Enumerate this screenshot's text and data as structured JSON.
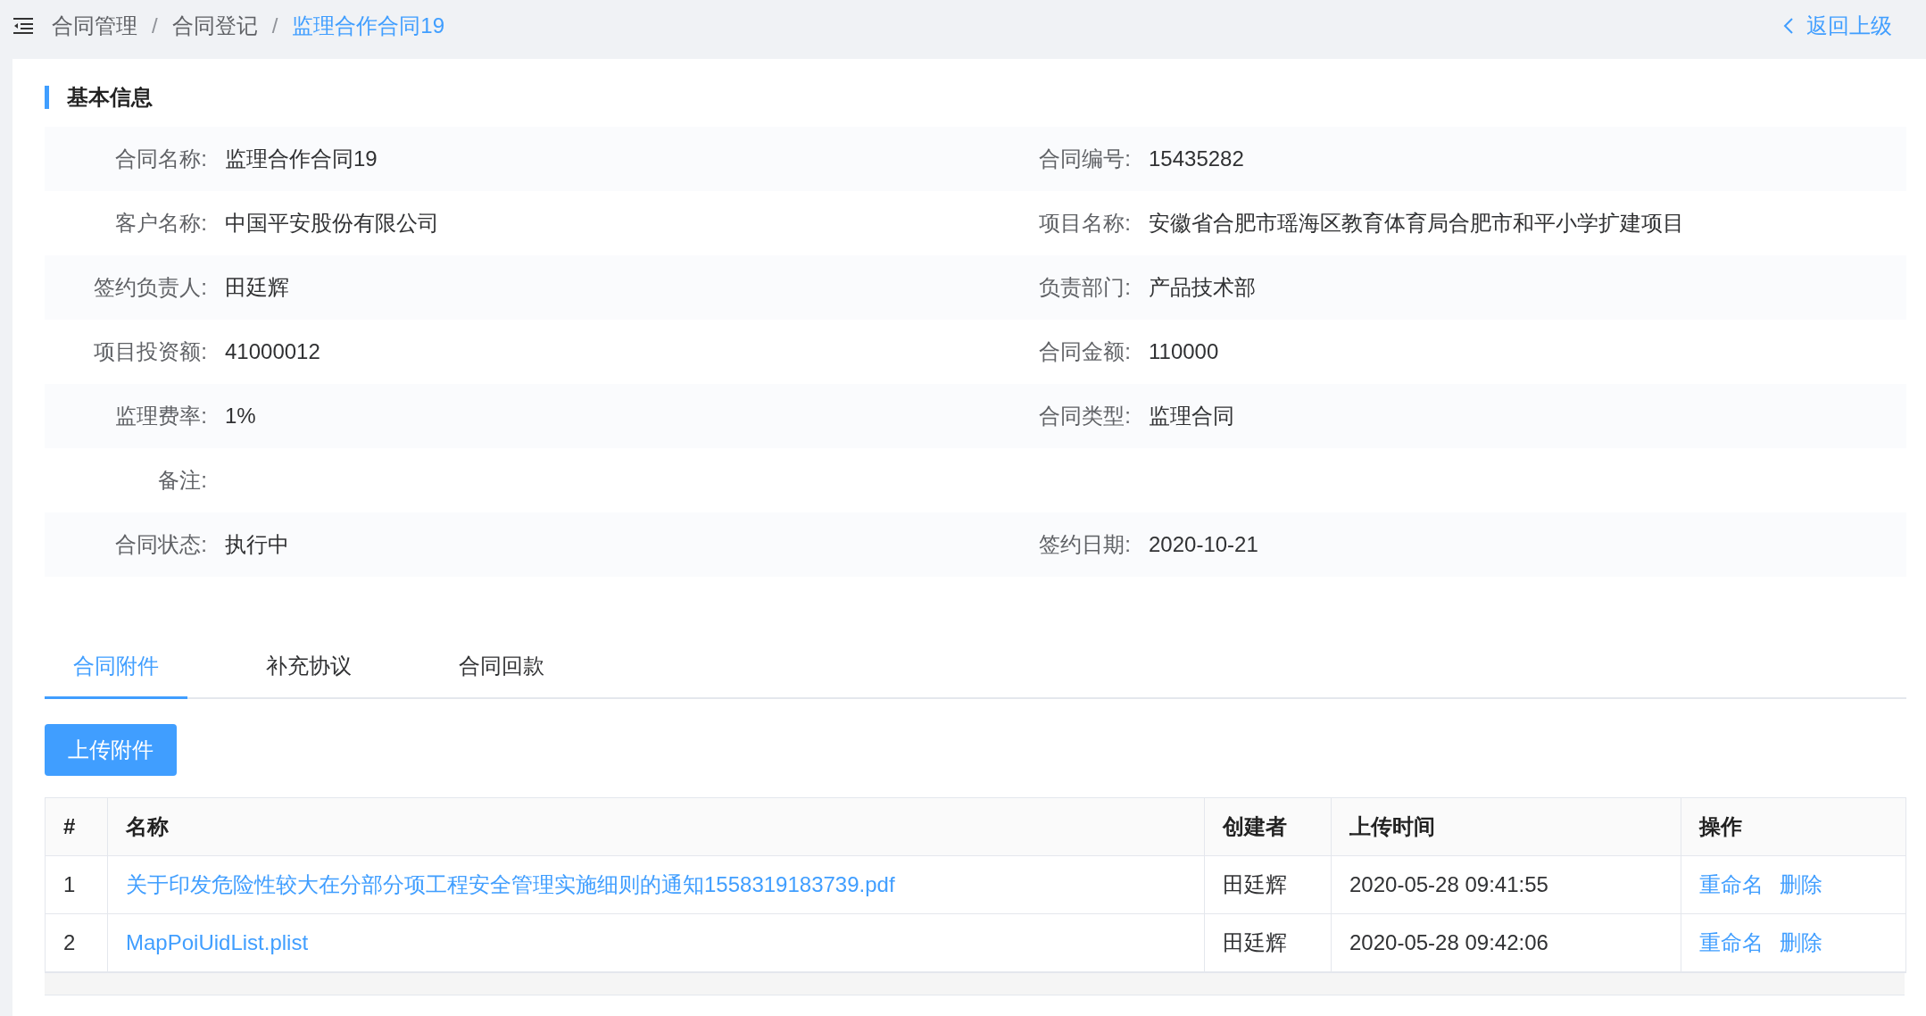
{
  "breadcrumb": [
    {
      "label": "合同管理",
      "current": false
    },
    {
      "label": "合同登记",
      "current": false
    },
    {
      "label": "监理合作合同19",
      "current": true
    }
  ],
  "separator": "/",
  "back_link": "返回上级",
  "section_title": "基本信息",
  "info_rows": [
    {
      "cells": [
        {
          "label": "合同名称:",
          "value": "监理合作合同19"
        },
        {
          "label": "合同编号:",
          "value": "15435282"
        }
      ]
    },
    {
      "cells": [
        {
          "label": "客户名称:",
          "value": "中国平安股份有限公司"
        },
        {
          "label": "项目名称:",
          "value": "安徽省合肥市瑶海区教育体育局合肥市和平小学扩建项目"
        }
      ]
    },
    {
      "cells": [
        {
          "label": "签约负责人:",
          "value": "田廷辉"
        },
        {
          "label": "负责部门:",
          "value": "产品技术部"
        }
      ]
    },
    {
      "cells": [
        {
          "label": "项目投资额:",
          "value": "41000012"
        },
        {
          "label": "合同金额:",
          "value": "110000"
        }
      ]
    },
    {
      "cells": [
        {
          "label": "监理费率:",
          "value": "1%"
        },
        {
          "label": "合同类型:",
          "value": "监理合同"
        }
      ]
    },
    {
      "cells": [
        {
          "label": "备注:"
        }
      ]
    },
    {
      "cells": [
        {
          "label": "合同状态:",
          "value": "执行中"
        },
        {
          "label": "签约日期:",
          "value": "2020-10-21"
        }
      ]
    }
  ],
  "tabs": [
    {
      "label": "合同附件",
      "selected": true
    },
    {
      "label": "补充协议",
      "selected": false
    },
    {
      "label": "合同回款",
      "selected": false
    }
  ],
  "upload_button": "上传附件",
  "table": {
    "columns": [
      "#",
      "名称",
      "创建者",
      "上传时间",
      "操作"
    ],
    "rows": [
      {
        "index": "1",
        "name": "关于印发危险性较大在分部分项工程安全管理实施细则的通知1558319183739.pdf",
        "creator": "田廷辉",
        "time": "2020-05-28 09:41:55",
        "actions": [
          "重命名",
          "删除"
        ]
      },
      {
        "index": "2",
        "name": "MapPoiUidList.plist",
        "creator": "田廷辉",
        "time": "2020-05-28 09:42:06",
        "actions": [
          "重命名",
          "删除"
        ]
      }
    ]
  }
}
